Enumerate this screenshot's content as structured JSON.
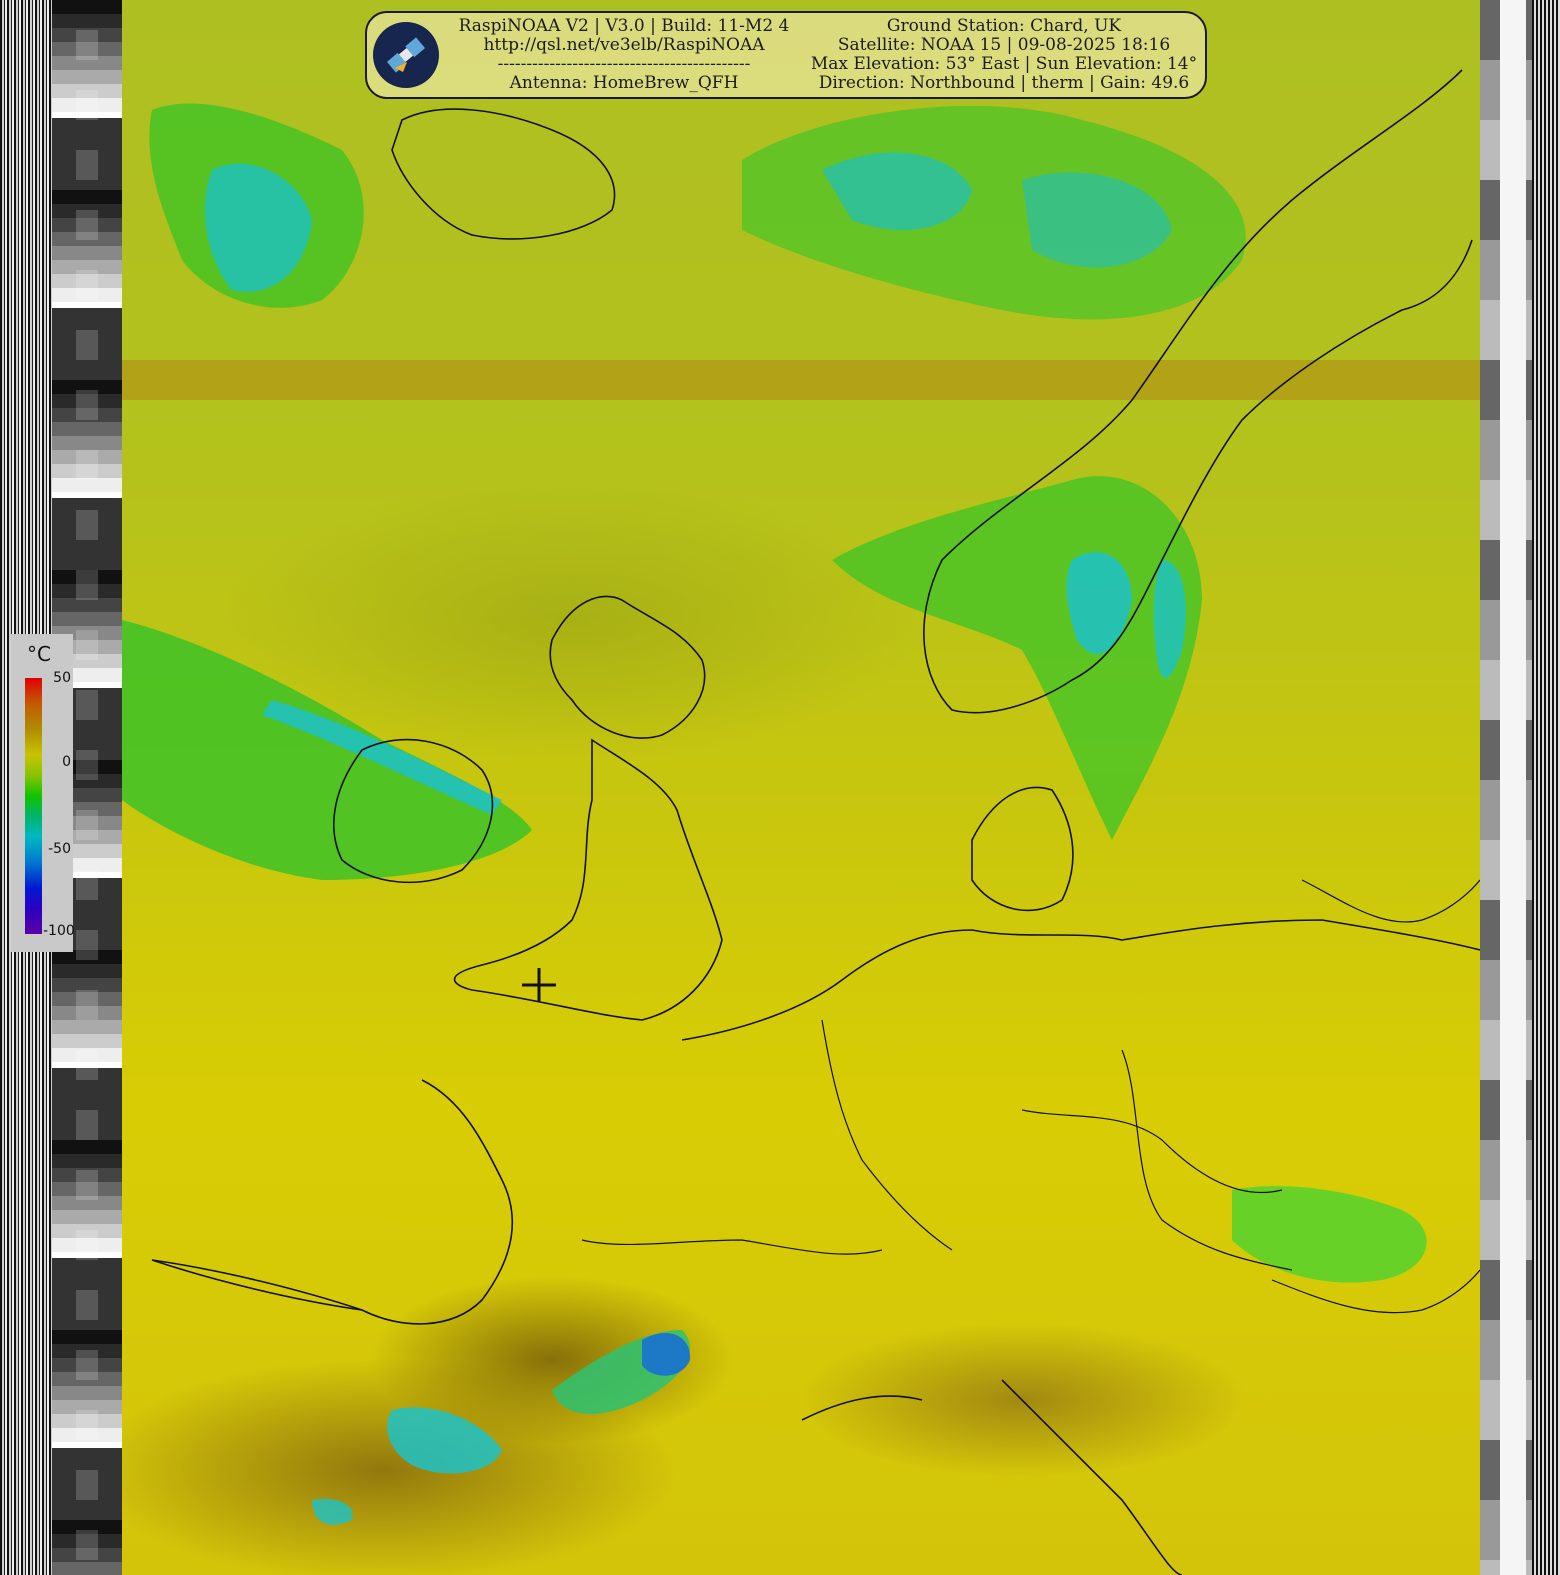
{
  "header": {
    "left_lines": [
      "RaspiNOAA V2 | V3.0 | Build: 11-M2 4",
      "http://qsl.net/ve3elb/RaspiNOAA",
      "--------------------------------------------",
      "Antenna: HomeBrew_QFH"
    ],
    "right_lines": [
      "Ground Station: Chard, UK",
      "Satellite: NOAA 15 | 09-08-2025 18:16",
      "Max Elevation: 53° East | Sun Elevation: 14°",
      "Direction: Northbound | therm | Gain: 49.6"
    ],
    "logo_icon": "satellite-icon"
  },
  "scale": {
    "unit": "°C",
    "ticks": [
      "50",
      "0",
      "-50",
      "-100"
    ],
    "min": -100,
    "max": 50
  },
  "colors": {
    "land_sea_base": "#d4c300",
    "cloud_green": "#33c01e",
    "cloud_cyan": "#18c0c8",
    "warm_brown": "#8a6a0e",
    "coastline": "#111111"
  }
}
